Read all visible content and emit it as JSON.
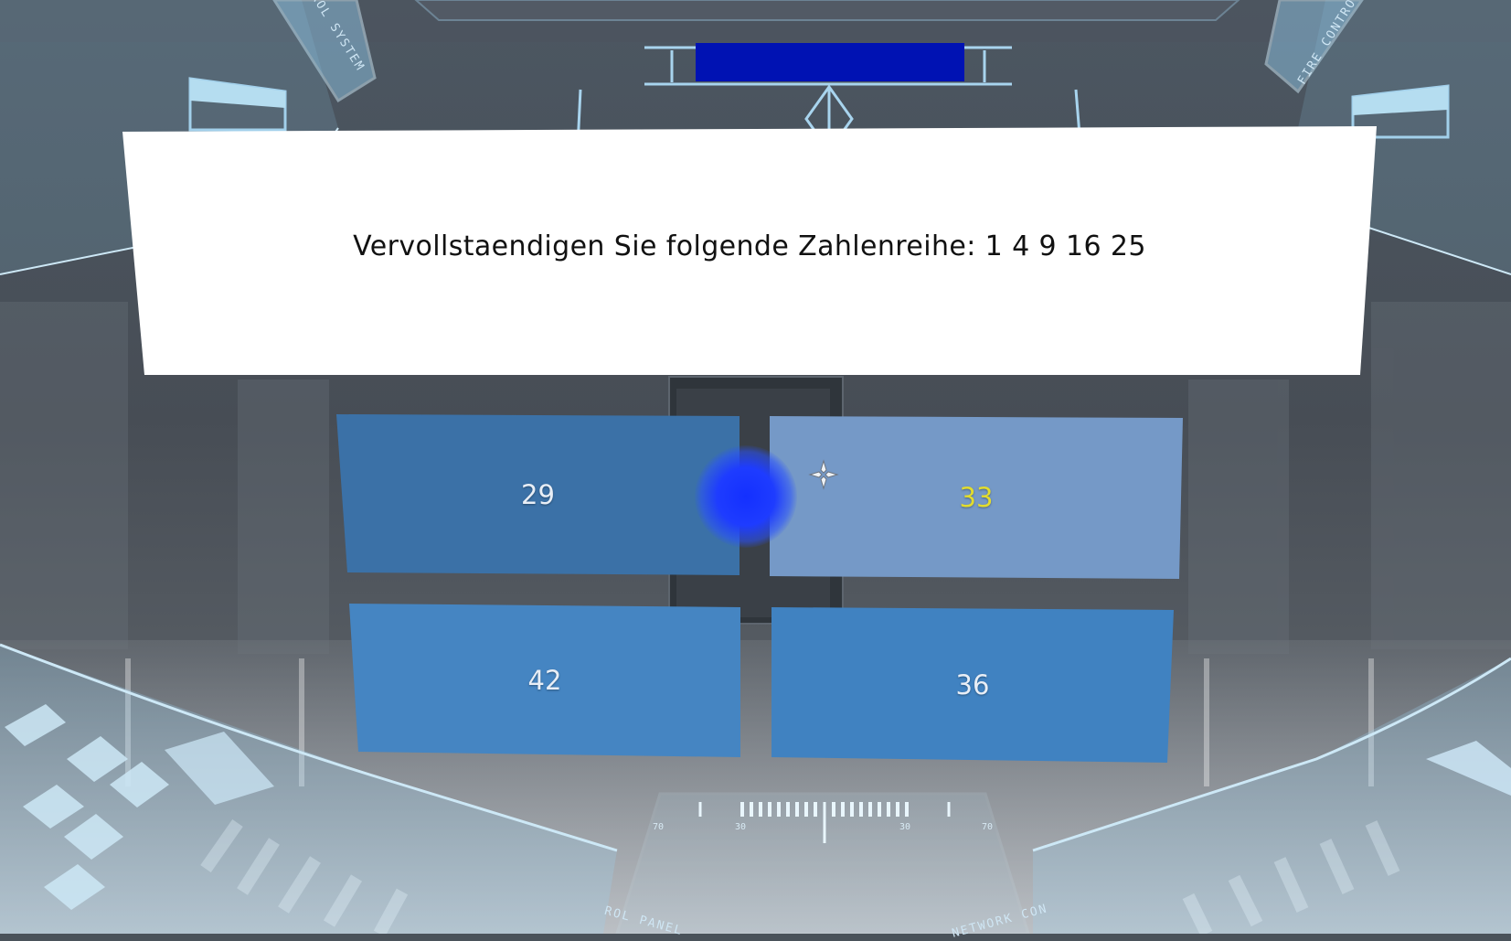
{
  "question": {
    "text": "Vervollstaendigen Sie folgende Zahlenreihe: 1 4 9 16 25"
  },
  "answers": [
    {
      "label": "29",
      "highlighted": false
    },
    {
      "label": "33",
      "highlighted": true
    },
    {
      "label": "42",
      "highlighted": false
    },
    {
      "label": "36",
      "highlighted": false
    }
  ],
  "hud": {
    "top_left_label": "ROL SYSTEM",
    "top_right_label": "FIRE CONTRO",
    "bottom_left_label": "ROL PANEL",
    "bottom_right_label": "NETWORK CON",
    "scale_ticks": [
      "70",
      "30",
      "30",
      "70"
    ]
  },
  "colors": {
    "header_bar": "#0012b3",
    "answer_highlight_text": "#e2dc2e",
    "hud_line": "#a8d4ee"
  }
}
